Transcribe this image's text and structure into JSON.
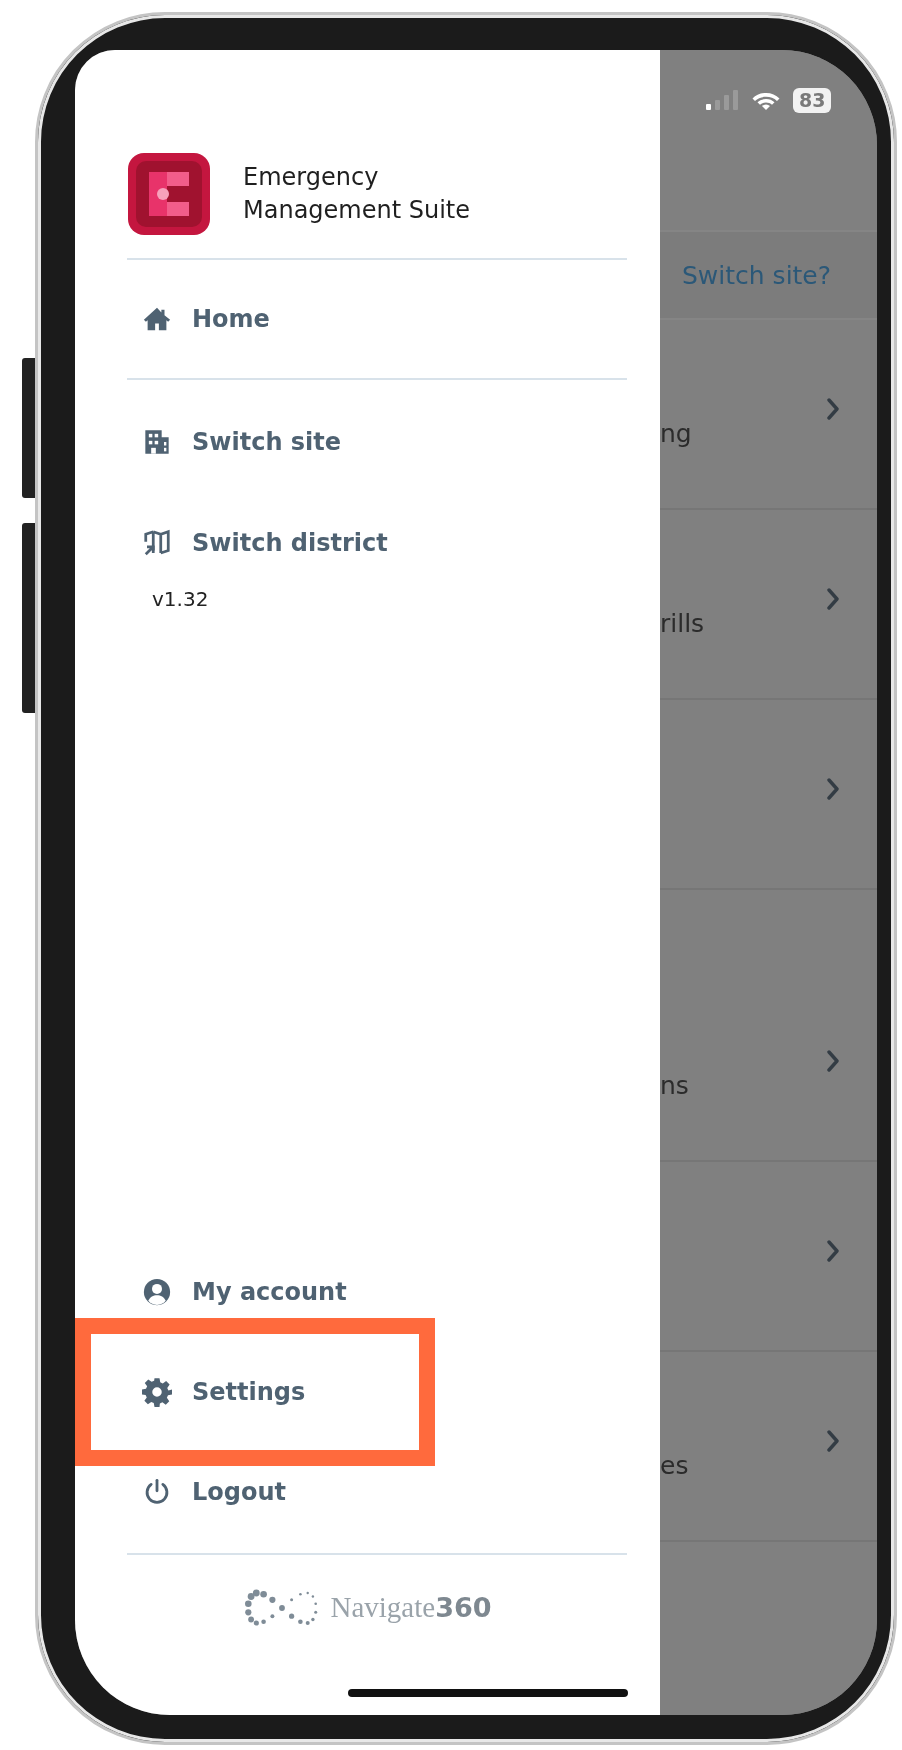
{
  "status_bar": {
    "battery": "83"
  },
  "drawer": {
    "app_title": "Emergency Management Suite",
    "nav_items": [
      {
        "label": "Home",
        "kind": "home"
      },
      {
        "label": "Switch site",
        "kind": "building"
      },
      {
        "label": "Switch district",
        "kind": "map"
      }
    ],
    "version": "v1.32",
    "account_items": [
      {
        "label": "My account",
        "kind": "user",
        "highlighted": false
      },
      {
        "label": "Settings",
        "kind": "gear",
        "highlighted": true
      },
      {
        "label": "Logout",
        "kind": "power",
        "highlighted": false
      }
    ],
    "footer_brand": "Navigate**360**"
  },
  "background_page": {
    "link": "Switch site?",
    "rows": [
      {
        "kind": "normal",
        "text": "ng"
      },
      {
        "kind": "normal",
        "text": "rills"
      },
      {
        "kind": "normal"
      },
      {
        "kind": "tall",
        "text": "ns"
      },
      {
        "kind": "normal"
      },
      {
        "kind": "normal",
        "text": "es"
      }
    ]
  }
}
